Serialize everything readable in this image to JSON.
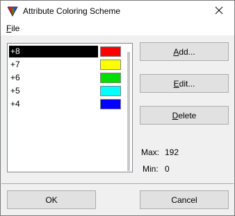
{
  "window": {
    "title": "Attribute Coloring Scheme",
    "close_glyph": "✕"
  },
  "menu": {
    "file": "File"
  },
  "list": {
    "items": [
      {
        "label": "+8",
        "color": "#ff0000",
        "selected": true
      },
      {
        "label": "+7",
        "color": "#ffff00",
        "selected": false
      },
      {
        "label": "+6",
        "color": "#00e000",
        "selected": false
      },
      {
        "label": "+5",
        "color": "#00ffff",
        "selected": false
      },
      {
        "label": "+4",
        "color": "#0000ff",
        "selected": false
      }
    ]
  },
  "buttons": {
    "add": "Add...",
    "edit": "Edit...",
    "delete": "Delete",
    "ok": "OK",
    "cancel": "Cancel"
  },
  "range": {
    "max_label": "Max:",
    "max_value": "192",
    "min_label": "Min:",
    "min_value": "0"
  },
  "icons": {
    "app": "color-triangle-icon",
    "close": "close-icon"
  }
}
